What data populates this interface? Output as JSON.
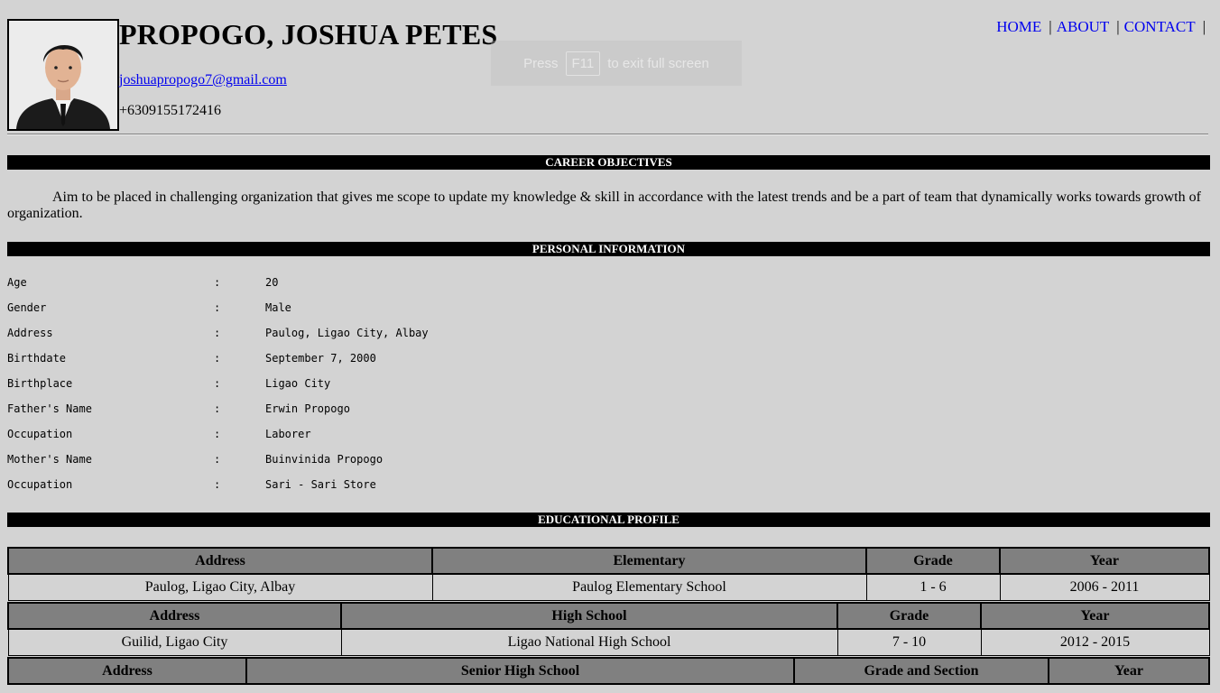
{
  "header": {
    "name": "PROPOGO, JOSHUA PETES",
    "email": "joshuapropogo7@gmail.com",
    "phone": "+6309155172416"
  },
  "nav": {
    "home": "HOME",
    "about": "ABOUT",
    "contact": "CONTACT",
    "separator": "|"
  },
  "fullscreen_hint": {
    "pre": "Press",
    "key": "F11",
    "post": "to exit full screen"
  },
  "sections": {
    "career": "CAREER OBJECTIVES",
    "personal": "PERSONAL INFORMATION",
    "education": "EDUCATIONAL PROFILE"
  },
  "objective": "Aim to be placed in challenging organization that gives me scope to update my knowledge & skill in accordance with the latest trends and be a part of team that dynamically works towards growth of organization.",
  "personal_info": [
    {
      "label": "Age",
      "colon": ":",
      "value": "20"
    },
    {
      "label": "Gender",
      "colon": ":",
      "value": "Male"
    },
    {
      "label": "Address",
      "colon": ":",
      "value": "Paulog, Ligao City, Albay"
    },
    {
      "label": "Birthdate",
      "colon": ":",
      "value": "September 7, 2000"
    },
    {
      "label": "Birthplace",
      "colon": ":",
      "value": "Ligao City"
    },
    {
      "label": "Father's Name",
      "colon": ":",
      "value": "Erwin Propogo"
    },
    {
      "label": "Occupation",
      "colon": ":",
      "value": "Laborer"
    },
    {
      "label": "Mother's Name",
      "colon": ":",
      "value": "Buinvinida Propogo"
    },
    {
      "label": "Occupation",
      "colon": ":",
      "value": "Sari - Sari Store"
    }
  ],
  "education": {
    "elementary": {
      "headers": [
        "Address",
        "Elementary",
        "Grade",
        "Year"
      ],
      "row": [
        "Paulog, Ligao City, Albay",
        "Paulog Elementary School",
        "1 - 6",
        "2006 - 2011"
      ]
    },
    "high_school": {
      "headers": [
        "Address",
        "High School",
        "Grade",
        "Year"
      ],
      "row": [
        "Guilid, Ligao City",
        "Ligao National High School",
        "7 - 10",
        "2012 - 2015"
      ]
    },
    "senior_high": {
      "headers": [
        "Address",
        "Senior High School",
        "Grade and Section",
        "Year"
      ]
    }
  }
}
